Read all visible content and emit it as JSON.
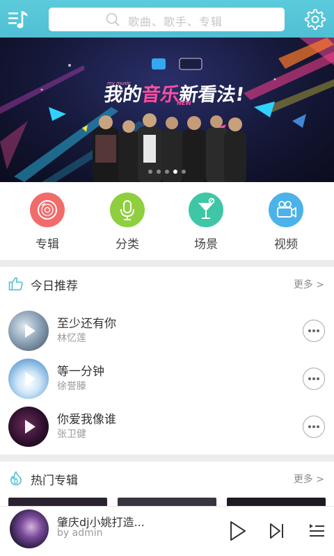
{
  "header": {
    "search_placeholder": "歌曲、歌手、专辑",
    "menu_icon": "menu-music-icon",
    "settings_icon": "gear-icon",
    "accent_color": "#55c5d8"
  },
  "banner": {
    "title_part1": "我的",
    "title_part2": "音乐",
    "title_part3": "新看法!",
    "subtitle": "my music",
    "new_badge": "NEW",
    "slide_count": 5,
    "active_slide": 4
  },
  "categories": [
    {
      "label": "专辑",
      "icon": "vinyl-icon",
      "color": "#f26b6b"
    },
    {
      "label": "分类",
      "icon": "microphone-icon",
      "color": "#8fcf3f"
    },
    {
      "label": "场景",
      "icon": "cocktail-icon",
      "color": "#3fc6a6"
    },
    {
      "label": "视频",
      "icon": "video-camera-icon",
      "color": "#4bb2ea"
    }
  ],
  "recommend": {
    "title": "今日推荐",
    "more": "更多 >",
    "songs": [
      {
        "title": "至少还有你",
        "artist": "林忆莲"
      },
      {
        "title": "等一分钟",
        "artist": "徐誉滕"
      },
      {
        "title": "你爱我像谁",
        "artist": "张卫健"
      }
    ]
  },
  "hot_albums": {
    "title": "热门专辑",
    "more": "更多 >"
  },
  "player": {
    "title": "肇庆dj小姚打造...",
    "artist": "by admin"
  }
}
